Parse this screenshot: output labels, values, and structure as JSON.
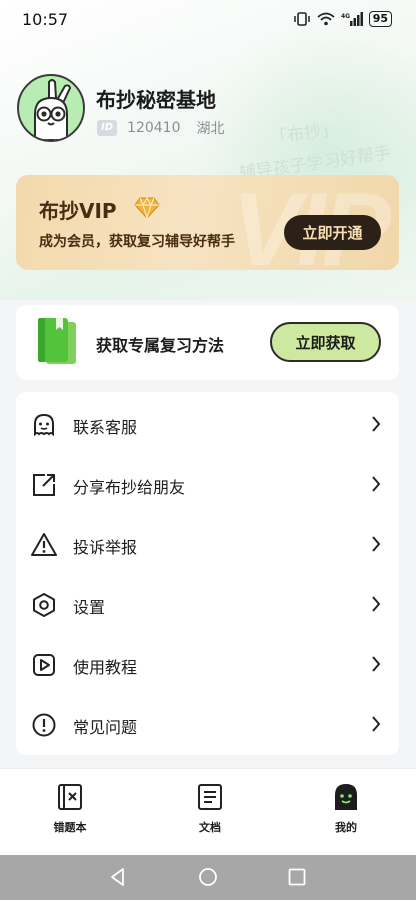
{
  "status_bar": {
    "time": "10:57",
    "battery": "95",
    "network": "4G"
  },
  "profile": {
    "name": "布抄秘密基地",
    "id_badge": "ID",
    "id": "120410",
    "region": "湖北",
    "avatar_icon": "rabbit-avatar-icon",
    "watermark_line1": "「布抄」",
    "watermark_line2": "辅导孩子学习好帮手"
  },
  "vip": {
    "title": "布抄VIP",
    "subtitle": "成为会员，获取复习辅导好帮手",
    "button": "立即开通",
    "background_text": "VIP",
    "colors": {
      "card": "#f3d9ac",
      "button": "#2b2118",
      "text": "#4a2c12"
    }
  },
  "promo": {
    "text": "获取专属复习方法",
    "button": "立即获取",
    "colors": {
      "button": "#cde99f"
    }
  },
  "menu": {
    "items": [
      {
        "label": "联系客服",
        "icon": "customer-service-icon"
      },
      {
        "label": "分享布抄给朋友",
        "icon": "share-icon"
      },
      {
        "label": "投诉举报",
        "icon": "warning-icon"
      },
      {
        "label": "设置",
        "icon": "settings-icon"
      },
      {
        "label": "使用教程",
        "icon": "video-tutorial-icon"
      },
      {
        "label": "常见问题",
        "icon": "faq-icon"
      }
    ]
  },
  "bottom_nav": {
    "items": [
      {
        "label": "错题本",
        "icon": "wrong-questions-icon"
      },
      {
        "label": "文档",
        "icon": "document-icon"
      },
      {
        "label": "我的",
        "icon": "profile-face-icon",
        "active": true
      }
    ]
  }
}
